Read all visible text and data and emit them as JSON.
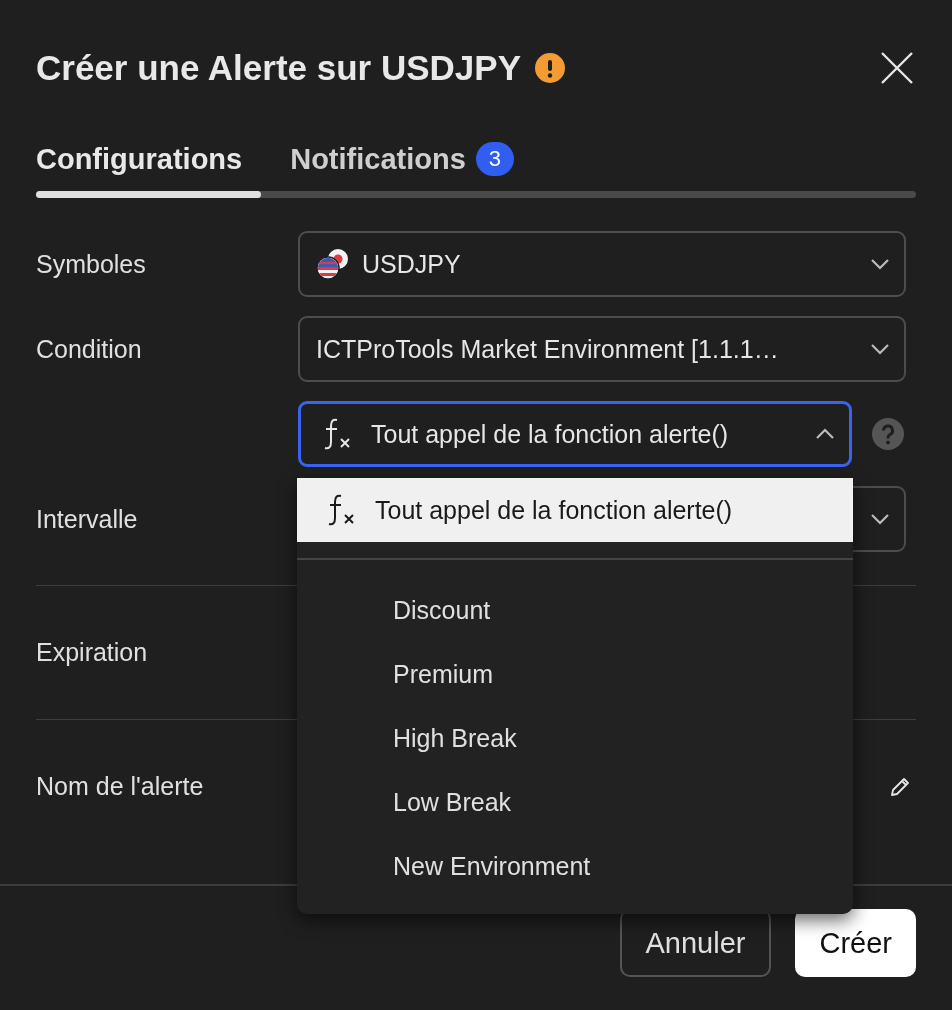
{
  "dialog": {
    "title": "Créer une Alerte sur USDJPY"
  },
  "tabs": [
    {
      "label": "Configurations",
      "selected": true
    },
    {
      "label": "Notifications",
      "selected": false,
      "badge": "3"
    }
  ],
  "tab_indicator": {
    "level": 0.256
  },
  "form": {
    "symbol": {
      "label": "Symboles",
      "value": "USDJPY"
    },
    "condition": {
      "label": "Condition",
      "value": "ICTProTools Market Environment [1.1.1…"
    },
    "trigger": {
      "value": "Tout appel de la fonction alerte()",
      "expanded": true
    },
    "interval": {
      "label": "Intervalle"
    },
    "expiration": {
      "label": "Expiration"
    },
    "alert_name": {
      "label": "Nom de l'alerte"
    }
  },
  "dropdown": {
    "groups": [
      {
        "options": [
          {
            "label": "Tout appel de la fonction alerte()",
            "kind": "function",
            "selected": true
          }
        ]
      },
      {
        "options": [
          {
            "label": "Discount",
            "kind": "plain",
            "selected": false
          },
          {
            "label": "Premium",
            "kind": "plain",
            "selected": false
          },
          {
            "label": "High Break",
            "kind": "plain",
            "selected": false
          },
          {
            "label": "Low Break",
            "kind": "plain",
            "selected": false
          },
          {
            "label": "New Environment",
            "kind": "plain",
            "selected": false
          }
        ]
      }
    ]
  },
  "buttons": [
    {
      "label": "Annuler",
      "kind": "secondary"
    },
    {
      "label": "Créer",
      "kind": "primary"
    }
  ]
}
